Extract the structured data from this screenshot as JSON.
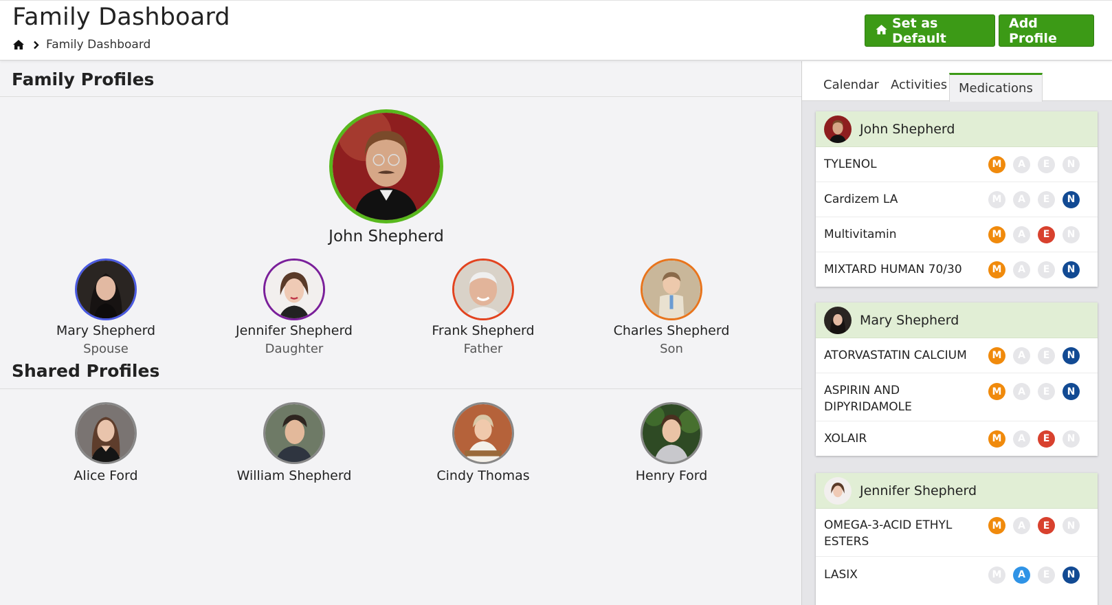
{
  "header": {
    "title": "Family Dashboard",
    "breadcrumb_current": "Family Dashboard",
    "set_default_label": "Set as Default",
    "add_profile_label": "Add Profile"
  },
  "family": {
    "section_title": "Family Profiles",
    "main": {
      "name": "John Shepherd"
    },
    "members": [
      {
        "name": "Mary Shepherd",
        "role": "Spouse"
      },
      {
        "name": "Jennifer Shepherd",
        "role": "Daughter"
      },
      {
        "name": "Frank Shepherd",
        "role": "Father"
      },
      {
        "name": "Charles Shepherd",
        "role": "Son"
      }
    ]
  },
  "shared": {
    "section_title": "Shared Profiles",
    "members": [
      {
        "name": "Alice Ford"
      },
      {
        "name": "William Shepherd"
      },
      {
        "name": "Cindy Thomas"
      },
      {
        "name": "Henry Ford"
      }
    ]
  },
  "tabs": [
    {
      "label": "Calendar",
      "active": false
    },
    {
      "label": "Activities",
      "active": false
    },
    {
      "label": "Medications",
      "active": true
    }
  ],
  "dose_labels": [
    "M",
    "A",
    "E",
    "N"
  ],
  "medications": [
    {
      "person": "John Shepherd",
      "items": [
        {
          "name": "TYLENOL",
          "doses": [
            true,
            false,
            false,
            false
          ]
        },
        {
          "name": "Cardizem LA",
          "doses": [
            false,
            false,
            false,
            true
          ]
        },
        {
          "name": "Multivitamin",
          "doses": [
            true,
            false,
            true,
            false
          ]
        },
        {
          "name": "MIXTARD HUMAN 70/30",
          "doses": [
            true,
            false,
            false,
            true
          ]
        }
      ]
    },
    {
      "person": "Mary Shepherd",
      "items": [
        {
          "name": "ATORVASTATIN CALCIUM",
          "doses": [
            true,
            false,
            false,
            true
          ]
        },
        {
          "name": "ASPIRIN AND DIPYRIDAMOLE",
          "doses": [
            true,
            false,
            false,
            true
          ]
        },
        {
          "name": "XOLAIR",
          "doses": [
            true,
            false,
            true,
            false
          ]
        }
      ]
    },
    {
      "person": "Jennifer Shepherd",
      "items": [
        {
          "name": "OMEGA-3-ACID ETHYL ESTERS",
          "doses": [
            true,
            false,
            true,
            false
          ]
        },
        {
          "name": "LASIX",
          "doses": [
            false,
            true,
            false,
            true
          ]
        }
      ]
    }
  ],
  "colors": {
    "brand_green": "#3c9a16",
    "dose_morning": "#f08a0c",
    "dose_afternoon": "#2f93e6",
    "dose_evening": "#d8412e",
    "dose_night": "#124a93",
    "ring_main": "#58b81d",
    "ring_spouse": "#4a5ae0",
    "ring_daughter": "#7a1f9a",
    "ring_father": "#e2431f",
    "ring_son": "#e8741c",
    "ring_shared": "#888888"
  },
  "icons": [
    "home-icon",
    "chevron-right-icon"
  ]
}
